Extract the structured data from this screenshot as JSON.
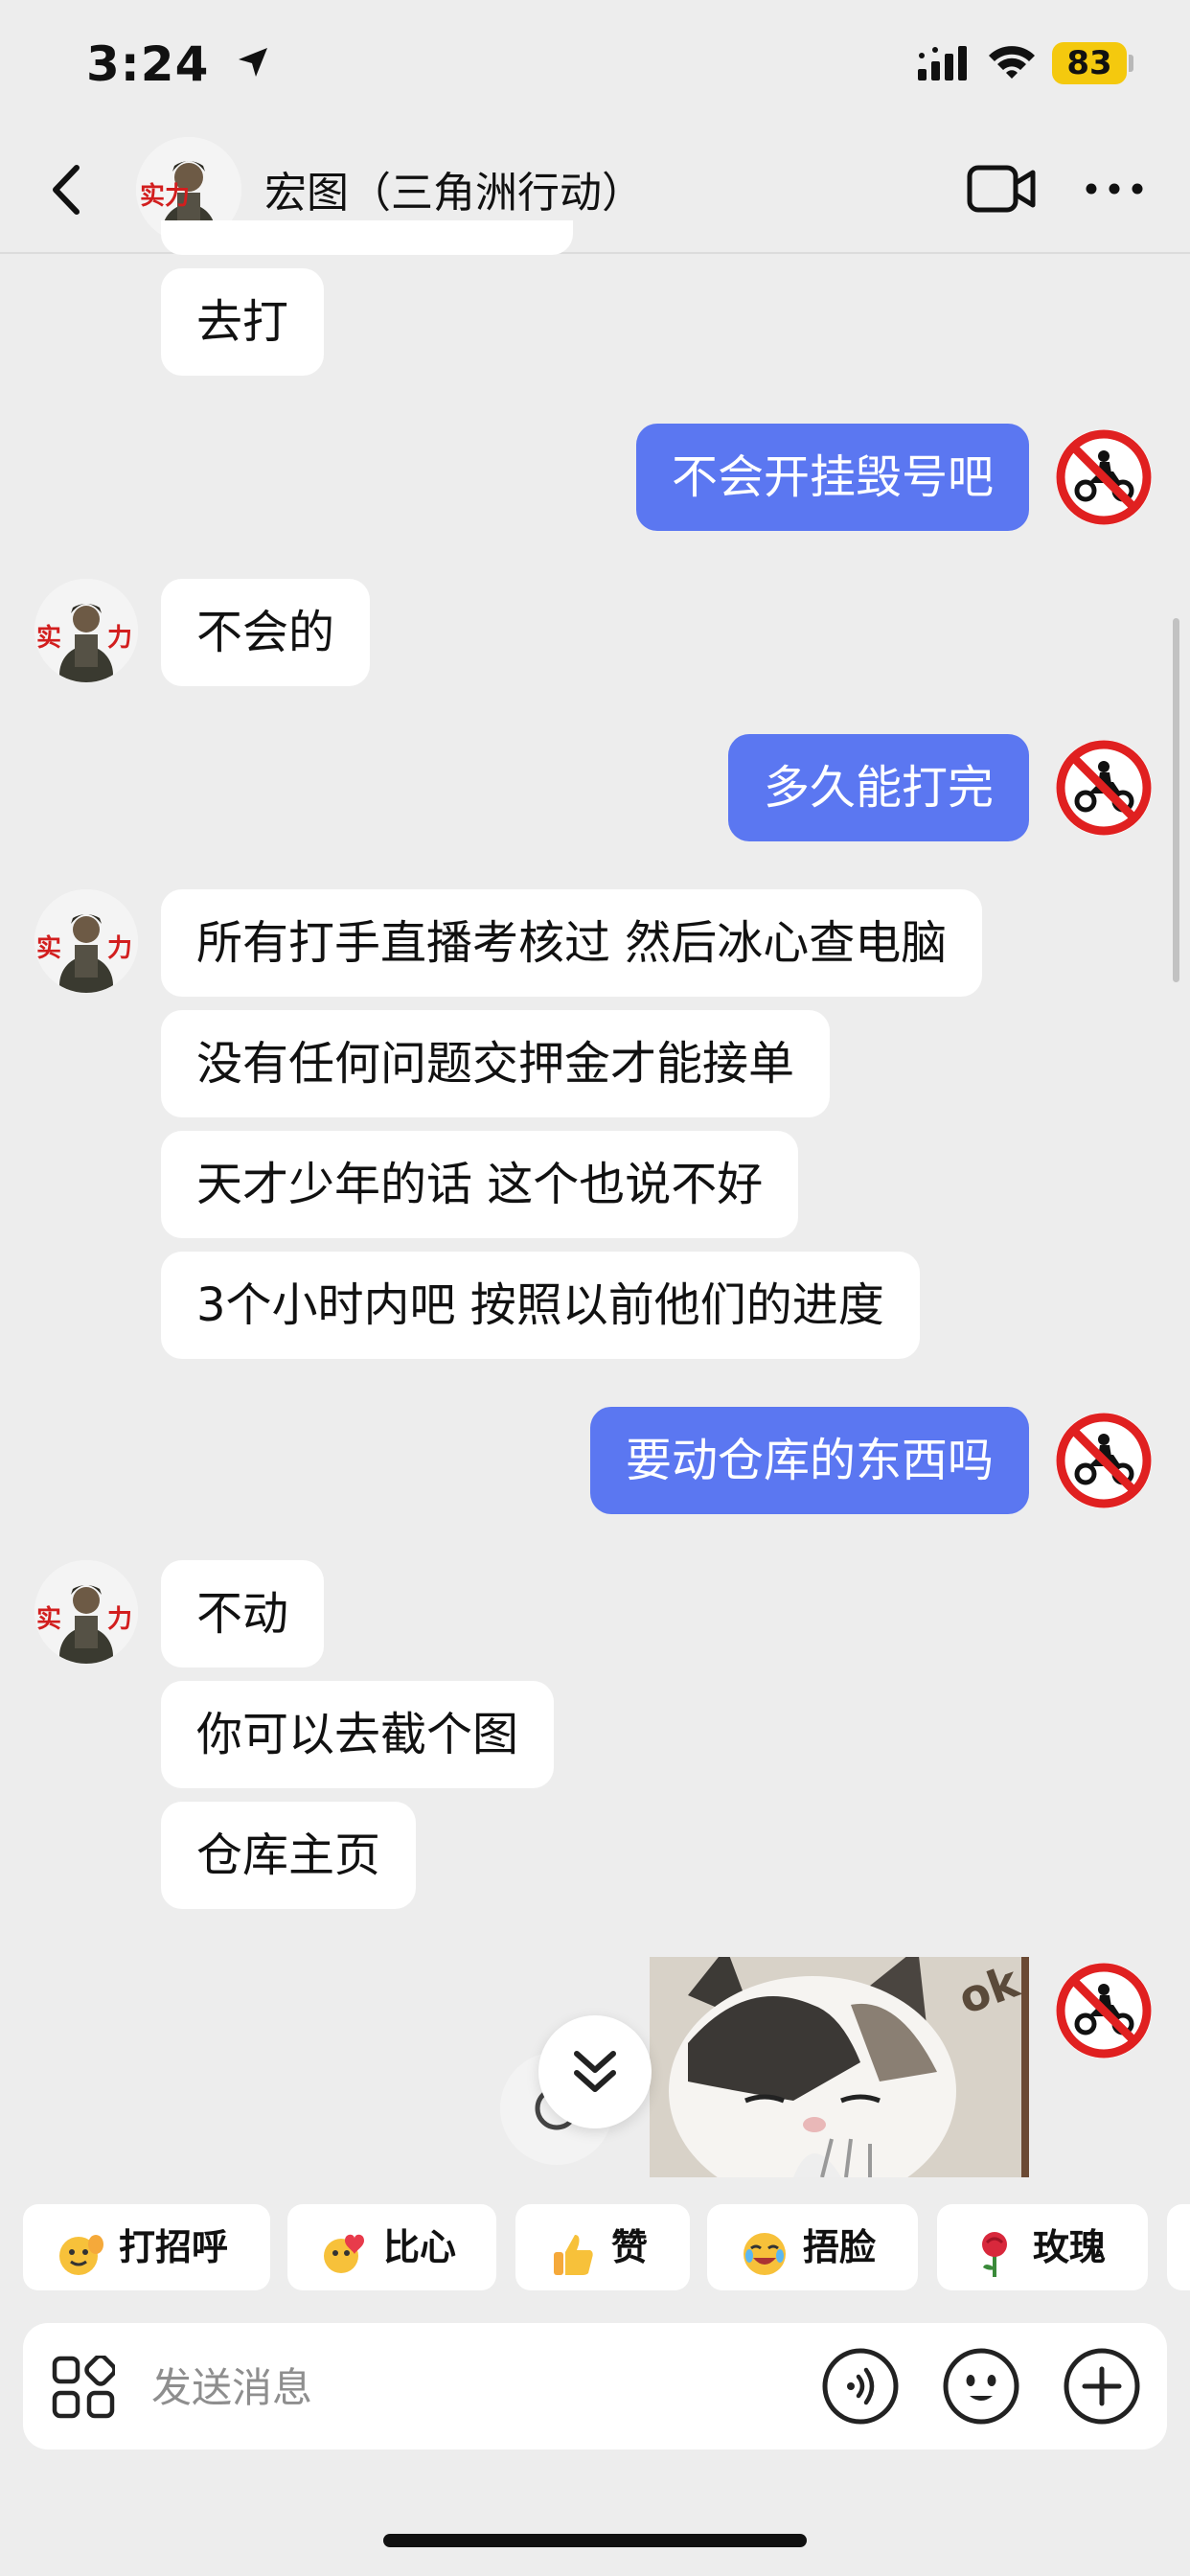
{
  "status": {
    "time": "3:24",
    "battery": "83"
  },
  "header": {
    "title": "宏图（三角洲行动）"
  },
  "avatar_badge_text": "实力",
  "messages": [
    {
      "side": "in",
      "text": "去打"
    },
    {
      "side": "out",
      "text": "不会开挂毁号吧"
    },
    {
      "side": "in",
      "text": "不会的"
    },
    {
      "side": "out",
      "text": "多久能打完"
    },
    {
      "side": "in",
      "text": "所有打手直播考核过 然后冰心查电脑"
    },
    {
      "side": "in",
      "text": "没有任何问题交押金才能接单"
    },
    {
      "side": "in",
      "text": "天才少年的话 这个也说不好"
    },
    {
      "side": "in",
      "text": "3个小时内吧 按照以前他们的进度"
    },
    {
      "side": "out",
      "text": "要动仓库的东西吗"
    },
    {
      "side": "in",
      "text": "不动"
    },
    {
      "side": "in",
      "text": "你可以去截个图"
    },
    {
      "side": "in",
      "text": "仓库主页"
    }
  ],
  "sticker": {
    "text": "ok"
  },
  "quick_replies": [
    {
      "label": "打招呼",
      "icon": "wave-emoji-icon"
    },
    {
      "label": "比心",
      "icon": "heart-hands-emoji-icon"
    },
    {
      "label": "赞",
      "icon": "thumbs-up-emoji-icon"
    },
    {
      "label": "捂脸",
      "icon": "facepalm-emoji-icon"
    },
    {
      "label": "玫瑰",
      "icon": "rose-emoji-icon"
    }
  ],
  "input": {
    "placeholder": "发送消息"
  },
  "colors": {
    "outgoing_bubble": "#5b77f1",
    "background": "#ededed",
    "battery": "#f4c90e"
  }
}
